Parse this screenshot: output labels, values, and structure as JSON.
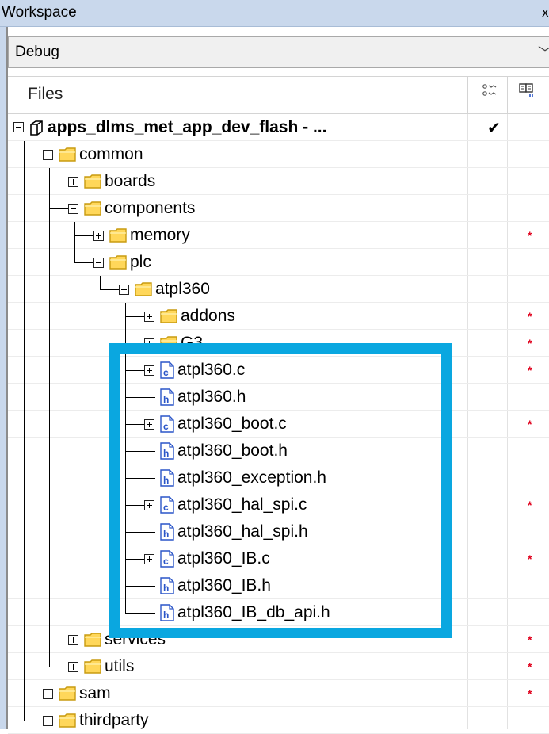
{
  "window": {
    "title": "Workspace",
    "close_glyph": "x"
  },
  "config": {
    "selected": "Debug"
  },
  "columns": {
    "files_header": "Files"
  },
  "project": {
    "name": "apps_dlms_met_app_dev_flash - ...",
    "check": "✔"
  },
  "tree": [
    {
      "label": "common",
      "level": 1,
      "type": "folder",
      "expander": "minus",
      "star": false
    },
    {
      "label": "boards",
      "level": 2,
      "type": "folder",
      "expander": "plus",
      "star": false
    },
    {
      "label": "components",
      "level": 2,
      "type": "folder",
      "expander": "minus",
      "star": false
    },
    {
      "label": "memory",
      "level": 3,
      "type": "folder",
      "expander": "plus",
      "star": true
    },
    {
      "label": "plc",
      "level": 3,
      "type": "folder",
      "expander": "minus",
      "star": false
    },
    {
      "label": "atpl360",
      "level": 4,
      "type": "folder",
      "expander": "minus",
      "star": false
    },
    {
      "label": "addons",
      "level": 5,
      "type": "folder",
      "expander": "plus",
      "star": true
    },
    {
      "label": "G3",
      "level": 5,
      "type": "folder",
      "expander": "plus",
      "star": true
    },
    {
      "label": "atpl360.c",
      "level": 5,
      "type": "c-file",
      "expander": "plus",
      "star": true
    },
    {
      "label": "atpl360.h",
      "level": 5,
      "type": "h-file",
      "expander": "none",
      "star": false
    },
    {
      "label": "atpl360_boot.c",
      "level": 5,
      "type": "c-file",
      "expander": "plus",
      "star": true
    },
    {
      "label": "atpl360_boot.h",
      "level": 5,
      "type": "h-file",
      "expander": "none",
      "star": false
    },
    {
      "label": "atpl360_exception.h",
      "level": 5,
      "type": "h-file",
      "expander": "none",
      "star": false
    },
    {
      "label": "atpl360_hal_spi.c",
      "level": 5,
      "type": "c-file",
      "expander": "plus",
      "star": true
    },
    {
      "label": "atpl360_hal_spi.h",
      "level": 5,
      "type": "h-file",
      "expander": "none",
      "star": false
    },
    {
      "label": "atpl360_IB.c",
      "level": 5,
      "type": "c-file",
      "expander": "plus",
      "star": true
    },
    {
      "label": "atpl360_IB.h",
      "level": 5,
      "type": "h-file",
      "expander": "none",
      "star": false
    },
    {
      "label": "atpl360_IB_db_api.h",
      "level": 5,
      "type": "h-file",
      "expander": "none",
      "star": false
    },
    {
      "label": "services",
      "level": 2,
      "type": "folder",
      "expander": "plus",
      "star": true
    },
    {
      "label": "utils",
      "level": 2,
      "type": "folder",
      "expander": "plus",
      "star": true
    },
    {
      "label": "sam",
      "level": 1,
      "type": "folder",
      "expander": "plus",
      "star": true
    },
    {
      "label": "thirdparty",
      "level": 1,
      "type": "folder",
      "expander": "minus",
      "star": false
    }
  ],
  "modified_marker": "*",
  "colors": {
    "highlight": "#0aa7e0",
    "folder_fill": "#ffd75a",
    "folder_stroke": "#c89b10",
    "file_stroke": "#2a55c8",
    "star": "#e0001c",
    "title_bar": "#c9d8ec"
  },
  "icons": {
    "project": "cube-icon",
    "folder": "folder-icon",
    "c_file": "c-source-file-icon",
    "h_file": "header-file-icon",
    "column_1": "toggle-build-icon",
    "column_2": "output-status-icon"
  }
}
